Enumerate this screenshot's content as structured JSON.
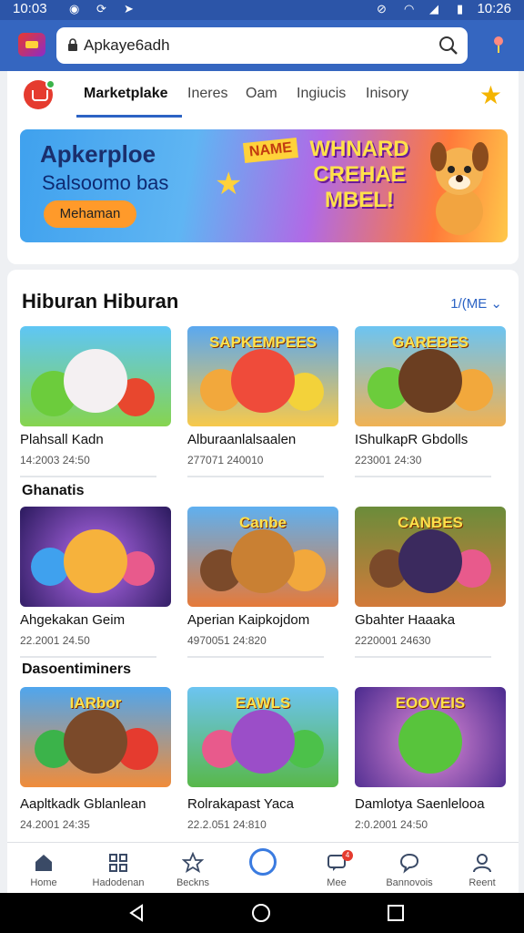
{
  "status_bar": {
    "time_left": "10:03",
    "time_right": "10:26"
  },
  "browser": {
    "url": "Apkaye6adh"
  },
  "nav": {
    "tabs": [
      {
        "label": "Marketplake",
        "active": true
      },
      {
        "label": "Ineres",
        "active": false
      },
      {
        "label": "Oam",
        "active": false
      },
      {
        "label": "Ingiucis",
        "active": false
      },
      {
        "label": "Inisory",
        "active": false
      }
    ]
  },
  "banner": {
    "title": "Apkerploe",
    "subtitle": "Salsoomo bas",
    "button": "Mehaman",
    "tag": "NAME",
    "big_text": "WHNARD CREHAE MBEL!"
  },
  "section1": {
    "title": "Hiburan Hiburan",
    "more": "1/(ME",
    "items": [
      {
        "title": "Plahsall Kadn",
        "meta": "14:2003 24:50",
        "thumb_title": ""
      },
      {
        "title": "Alburaanlalsaalen",
        "meta": "277071 240010",
        "thumb_title": "SAPKEMPEES"
      },
      {
        "title": "IShulkapR Gbdolls",
        "meta": "223001 24:30",
        "thumb_title": "GAREBES"
      }
    ]
  },
  "section2": {
    "title": "Ghanatis",
    "items": [
      {
        "title": "Ahgekakan Geim",
        "meta": "22.2001 24.50",
        "thumb_title": ""
      },
      {
        "title": "Aperian Kaipkojdom",
        "meta": "4970051 24:820",
        "thumb_title": "Canbe"
      },
      {
        "title": "Gbahter Haaaka",
        "meta": "2220001 24630",
        "thumb_title": "CANBES"
      }
    ]
  },
  "section3": {
    "title": "Dasoentiminers",
    "items": [
      {
        "title": "Aapltkadk Gblanlean",
        "meta": "24.2001 24:35",
        "thumb_title": "IARbor"
      },
      {
        "title": "Rolrakapast Yaca",
        "meta": "22.2.051 24:810",
        "thumb_title": "EAWLS"
      },
      {
        "title": "Damlotya Saenlelooa",
        "meta": "2:0.2001 24:50",
        "thumb_title": "EOOVEIS"
      }
    ]
  },
  "bottom_nav": [
    {
      "label": "Home",
      "icon": "home-icon"
    },
    {
      "label": "Hadodenan",
      "icon": "grid-icon"
    },
    {
      "label": "Beckns",
      "icon": "star-outline-icon"
    },
    {
      "label": "",
      "icon": "app-center-icon"
    },
    {
      "label": "Mee",
      "icon": "chat-icon",
      "badge": "4"
    },
    {
      "label": "Bannovois",
      "icon": "bubble-icon"
    },
    {
      "label": "Reent",
      "icon": "person-icon"
    }
  ],
  "colors": {
    "accent": "#2c63c4",
    "header": "#3566c0",
    "status": "#2c55a8"
  }
}
